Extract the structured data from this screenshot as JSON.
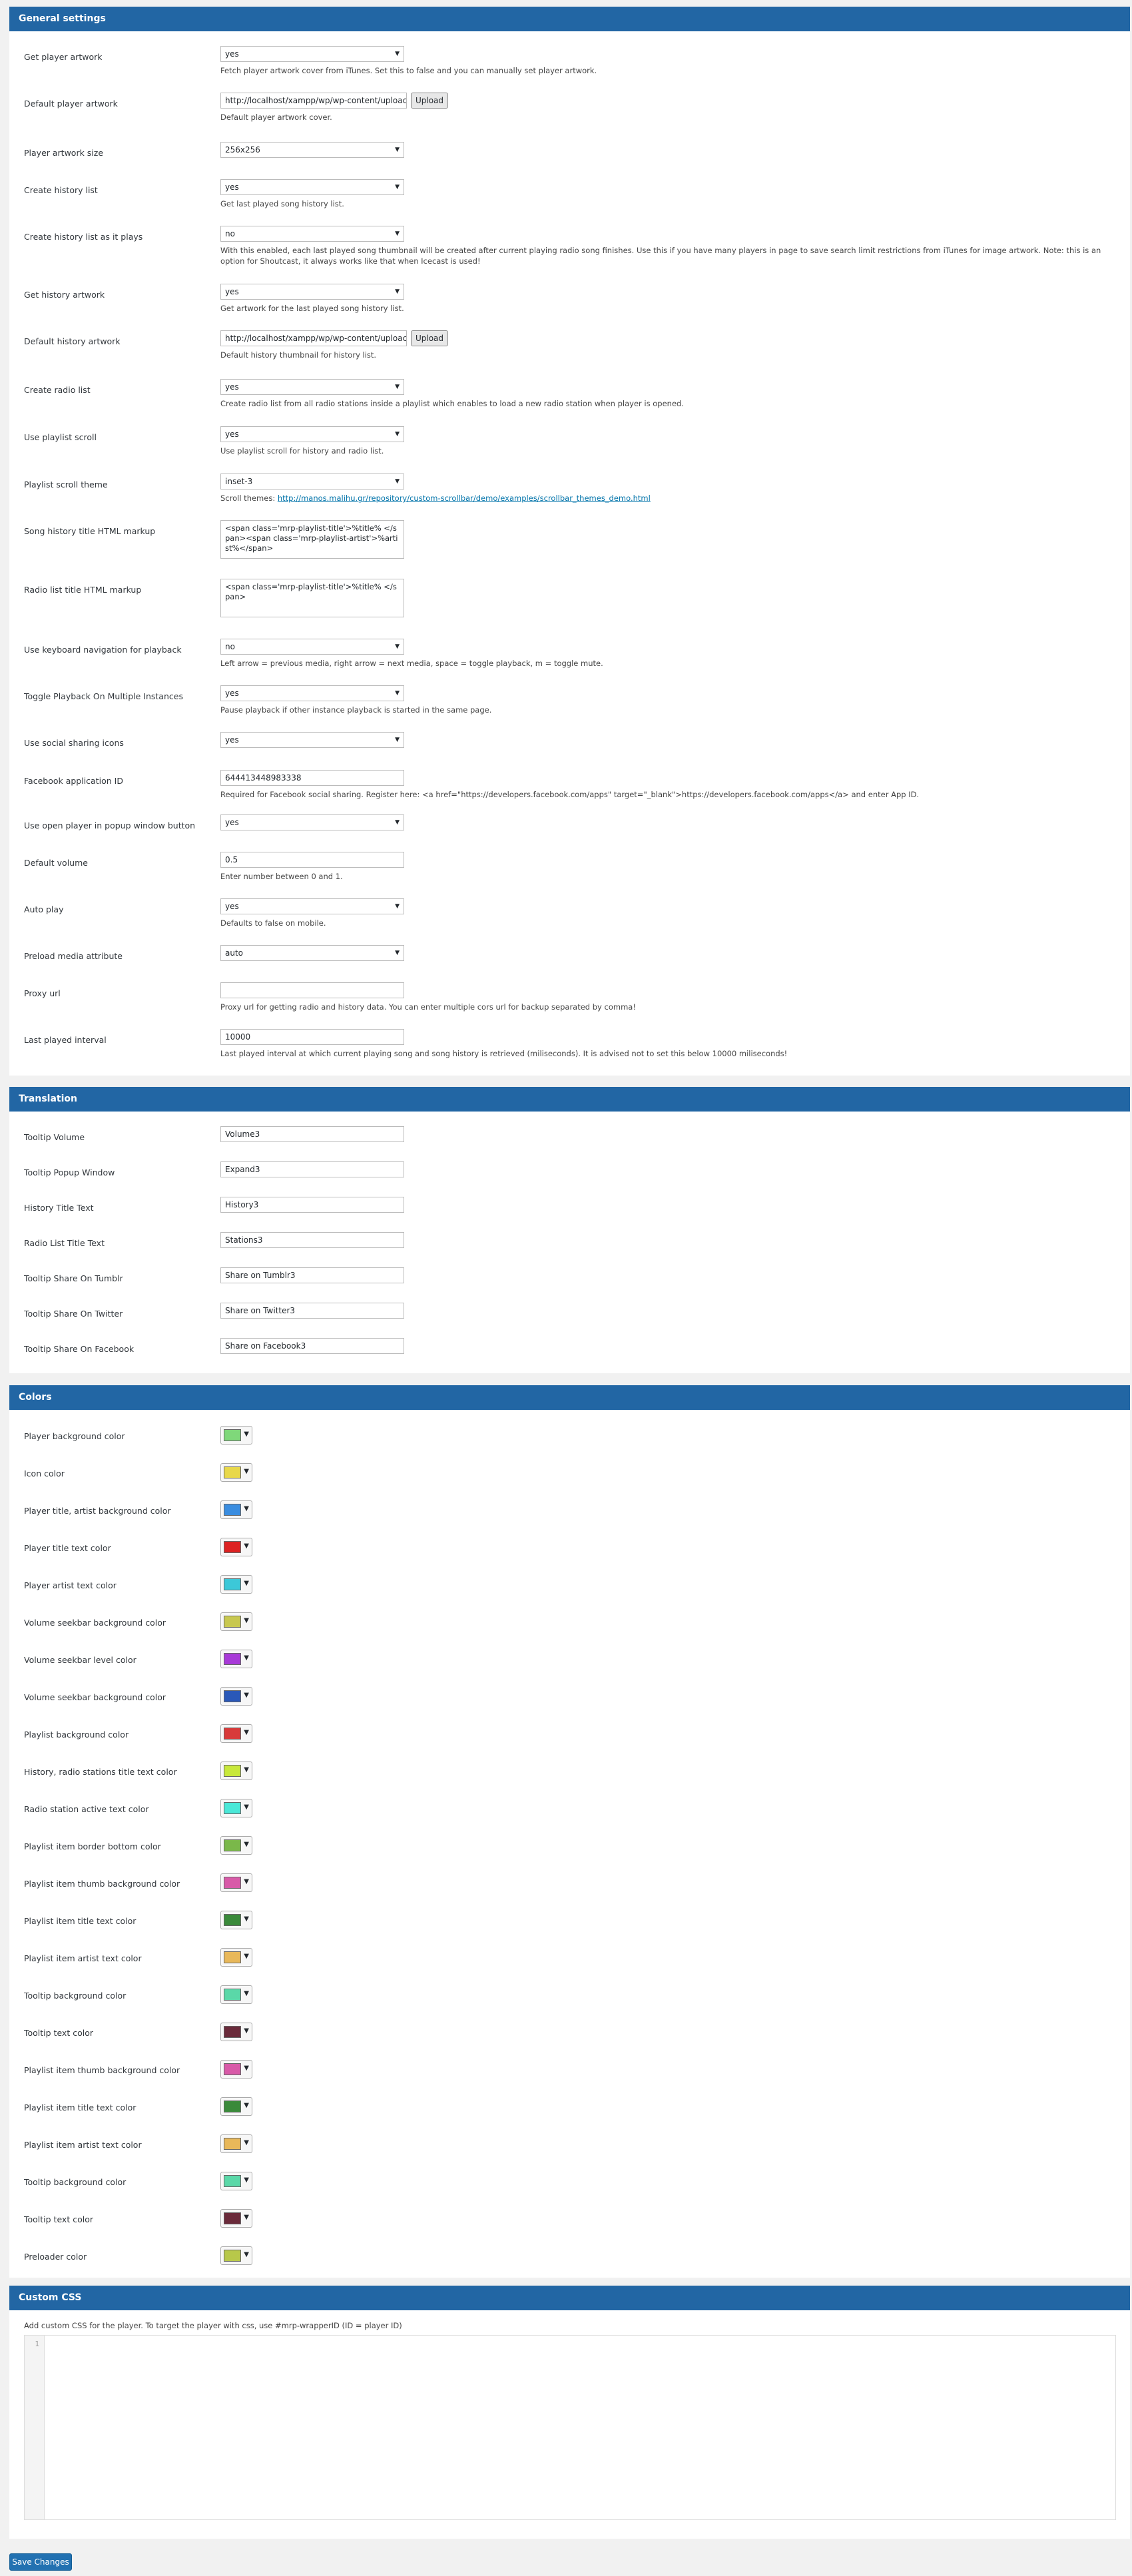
{
  "general": {
    "title": "General settings",
    "get_player_artwork": {
      "label": "Get player artwork",
      "value": "yes",
      "desc": "Fetch player artwork cover from iTunes. Set this to false and you can manually set player artwork."
    },
    "default_player_artwork": {
      "label": "Default player artwork",
      "value": "http://localhost/xampp/wp/wp-content/uploac",
      "upload": "Upload",
      "desc": "Default player artwork cover."
    },
    "player_artwork_size": {
      "label": "Player artwork size",
      "value": "256x256"
    },
    "create_history_list": {
      "label": "Create history list",
      "value": "yes",
      "desc": "Get last played song history list."
    },
    "create_history_list_as_it_plays": {
      "label": "Create history list as it plays",
      "value": "no",
      "desc": "With this enabled, each last played song thumbnail will be created after current playing radio song finishes. Use this if you have many players in page to save search limit restrictions from iTunes for image artwork. Note: this is an option for Shoutcast, it always works like that when Icecast is used!"
    },
    "get_history_artwork": {
      "label": "Get history artwork",
      "value": "yes",
      "desc": "Get artwork for the last played song history list."
    },
    "default_history_artwork": {
      "label": "Default history artwork",
      "value": "http://localhost/xampp/wp/wp-content/uploac",
      "upload": "Upload",
      "desc": "Default history thumbnail for history list."
    },
    "create_radio_list": {
      "label": "Create radio list",
      "value": "yes",
      "desc": "Create radio list from all radio stations inside a playlist which enables to load a new radio station when player is opened."
    },
    "use_playlist_scroll": {
      "label": "Use playlist scroll",
      "value": "yes",
      "desc": "Use playlist scroll for history and radio list."
    },
    "playlist_scroll_theme": {
      "label": "Playlist scroll theme",
      "value": "inset-3",
      "desc_prefix": "Scroll themes:",
      "desc_link": "http://manos.malihu.gr/repository/custom-scrollbar/demo/examples/scrollbar_themes_demo.html"
    },
    "song_history_markup": {
      "label": "Song history title HTML markup",
      "value": "<span class='mrp-playlist-title'>%title% </span><span class='mrp-playlist-artist'>%artist%</span>"
    },
    "radio_list_markup": {
      "label": "Radio list title HTML markup",
      "value": "<span class='mrp-playlist-title'>%title% </span>"
    },
    "keyboard_nav": {
      "label": "Use keyboard navigation for playback",
      "value": "no",
      "desc": "Left arrow = previous media, right arrow = next media, space = toggle playback, m = toggle mute."
    },
    "toggle_multiple": {
      "label": "Toggle Playback On Multiple Instances",
      "value": "yes",
      "desc": "Pause playback if other instance playback is started in the same page."
    },
    "social_icons": {
      "label": "Use social sharing icons",
      "value": "yes"
    },
    "facebook_app_id": {
      "label": "Facebook application ID",
      "value": "644413448983338",
      "desc": "Required for Facebook social sharing. Register here: <a href=\"https://developers.facebook.com/apps\" target=\"_blank\">https://developers.facebook.com/apps</a> and enter App ID."
    },
    "open_popup_button": {
      "label": "Use open player in popup window button",
      "value": "yes"
    },
    "default_volume": {
      "label": "Default volume",
      "value": "0.5",
      "desc": "Enter number between 0 and 1."
    },
    "auto_play": {
      "label": "Auto play",
      "value": "yes",
      "desc": "Defaults to false on mobile."
    },
    "preload_media": {
      "label": "Preload media attribute",
      "value": "auto"
    },
    "proxy_url": {
      "label": "Proxy url",
      "value": "",
      "desc": "Proxy url for getting radio and history data. You can enter multiple cors url for backup separated by comma!"
    },
    "last_played_interval": {
      "label": "Last played interval",
      "value": "10000",
      "desc": "Last played interval at which current playing song and song history is retrieved (miliseconds). It is advised not to set this below 10000 miliseconds!"
    }
  },
  "translation": {
    "title": "Translation",
    "items": [
      {
        "label": "Tooltip Volume",
        "value": "Volume3"
      },
      {
        "label": "Tooltip Popup Window",
        "value": "Expand3"
      },
      {
        "label": "History Title Text",
        "value": "History3"
      },
      {
        "label": "Radio List Title Text",
        "value": "Stations3"
      },
      {
        "label": "Tooltip Share On Tumblr",
        "value": "Share on Tumblr3"
      },
      {
        "label": "Tooltip Share On Twitter",
        "value": "Share on Twitter3"
      },
      {
        "label": "Tooltip Share On Facebook",
        "value": "Share on Facebook3"
      }
    ]
  },
  "colors": {
    "title": "Colors",
    "items": [
      {
        "label": "Player background color",
        "color": "#7fd87a"
      },
      {
        "label": "Icon color",
        "color": "#e8d84a"
      },
      {
        "label": "Player title, artist background color",
        "color": "#3a8de0"
      },
      {
        "label": "Player title text color",
        "color": "#dd2222"
      },
      {
        "label": "Player artist text color",
        "color": "#3cc8d8"
      },
      {
        "label": "Volume seekbar background color",
        "color": "#c8c850"
      },
      {
        "label": "Volume seekbar level color",
        "color": "#a83ad8"
      },
      {
        "label": "Volume seekbar background color",
        "color": "#2a58b8"
      },
      {
        "label": "Playlist background color",
        "color": "#d83a3a"
      },
      {
        "label": "History, radio stations title text color",
        "color": "#c8e83a"
      },
      {
        "label": "Radio station active text color",
        "color": "#4ae8d8"
      },
      {
        "label": "Playlist item border bottom color",
        "color": "#7ab84a"
      },
      {
        "label": "Playlist item thumb background color",
        "color": "#d85aa8"
      },
      {
        "label": "Playlist item title text color",
        "color": "#3a8a3a"
      },
      {
        "label": "Playlist item artist text color",
        "color": "#e8b85a"
      },
      {
        "label": "Tooltip background color",
        "color": "#5ad8a8"
      },
      {
        "label": "Tooltip text color",
        "color": "#6a2a3a"
      },
      {
        "label": "Playlist item thumb background color",
        "color": "#d85aa8"
      },
      {
        "label": "Playlist item title text color",
        "color": "#3a8a3a"
      },
      {
        "label": "Playlist item artist text color",
        "color": "#e8b85a"
      },
      {
        "label": "Tooltip background color",
        "color": "#5ad8a8"
      },
      {
        "label": "Tooltip text color",
        "color": "#6a2a3a"
      },
      {
        "label": "Preloader color",
        "color": "#b8c84a"
      }
    ]
  },
  "custom_css": {
    "title": "Custom CSS",
    "desc": "Add custom CSS for the player. To target the player with css, use #mrp-wrapperID (ID = player ID)",
    "line_number": "1"
  },
  "save_button": "Save Changes"
}
